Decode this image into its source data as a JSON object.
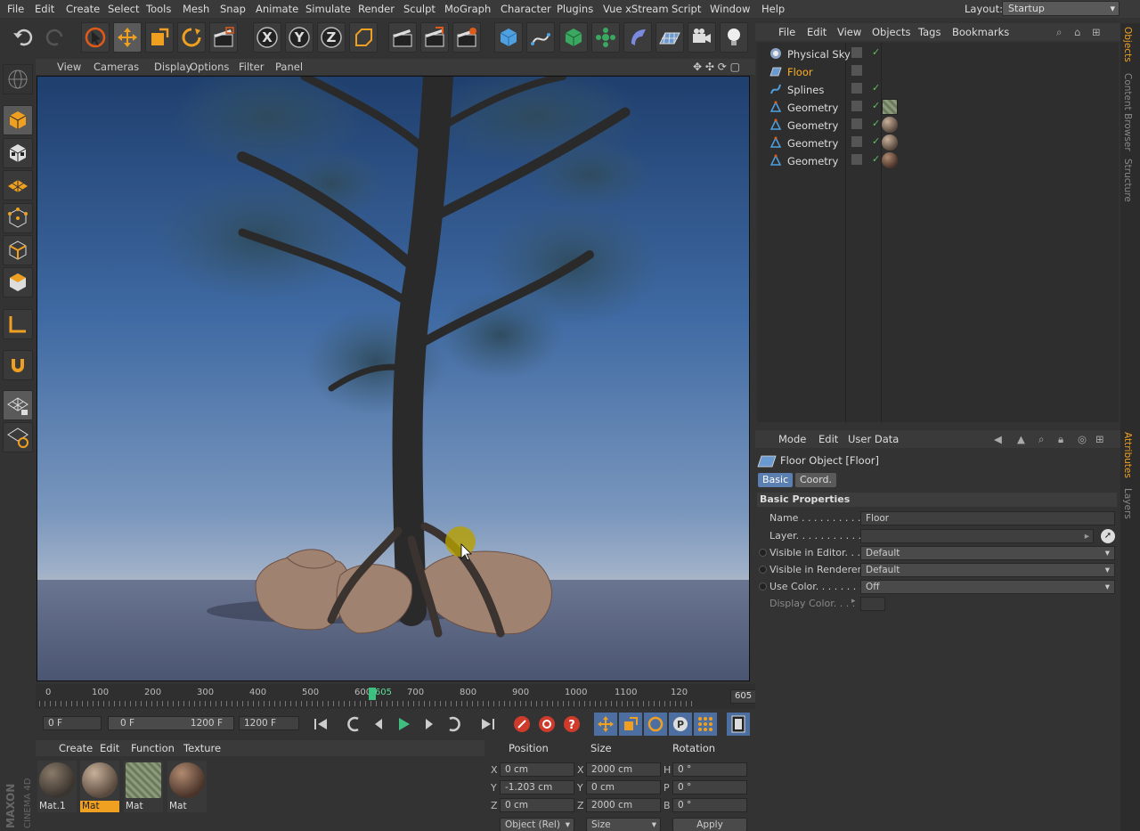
{
  "menu": [
    "File",
    "Edit",
    "Create",
    "Select",
    "Tools",
    "Mesh",
    "Snap",
    "Animate",
    "Simulate",
    "Render",
    "Sculpt",
    "MoGraph",
    "Character",
    "Plugins",
    "Vue xStream",
    "Script",
    "Window",
    "Help"
  ],
  "layout": {
    "label": "Layout:",
    "value": "Startup"
  },
  "viewport": {
    "menu": [
      "View",
      "Cameras",
      "Display",
      "Options",
      "Filter",
      "Panel"
    ]
  },
  "timeline": {
    "ticks": [
      "0",
      "100",
      "200",
      "300",
      "400",
      "500",
      "600",
      "700",
      "800",
      "900",
      "1000",
      "1100",
      "120"
    ],
    "current_marker": "605",
    "current_field": "605 F",
    "playhead_percent": 50.4
  },
  "transport": {
    "start": "0 F",
    "range_start": "0 F",
    "range_end": "1200 F",
    "end": "1200 F"
  },
  "materials": {
    "menu": [
      "Create",
      "Edit",
      "Function",
      "Texture"
    ],
    "items": [
      {
        "label": "Mat.1",
        "selected": false
      },
      {
        "label": "Mat",
        "selected": true
      },
      {
        "label": "Mat",
        "selected": false
      },
      {
        "label": "Mat",
        "selected": false
      }
    ]
  },
  "coords": {
    "headers": [
      "Position",
      "Size",
      "Rotation"
    ],
    "rows": [
      {
        "axis": "X",
        "pos": "0 cm",
        "saxis": "X",
        "size": "2000 cm",
        "raxis": "H",
        "rot": "0 °"
      },
      {
        "axis": "Y",
        "pos": "-1.203 cm",
        "saxis": "Y",
        "size": "0 cm",
        "raxis": "P",
        "rot": "0 °"
      },
      {
        "axis": "Z",
        "pos": "0 cm",
        "saxis": "Z",
        "size": "2000 cm",
        "raxis": "B",
        "rot": "0 °"
      }
    ],
    "mode": "Object (Rel)",
    "size_mode": "Size",
    "apply": "Apply"
  },
  "objects": {
    "menu": [
      "File",
      "Edit",
      "View",
      "Objects",
      "Tags",
      "Bookmarks"
    ],
    "items": [
      {
        "name": "Physical Sky",
        "selected": false
      },
      {
        "name": "Floor",
        "selected": true
      },
      {
        "name": "Splines",
        "selected": false
      },
      {
        "name": "Geometry",
        "selected": false
      },
      {
        "name": "Geometry",
        "selected": false
      },
      {
        "name": "Geometry",
        "selected": false
      },
      {
        "name": "Geometry",
        "selected": false
      }
    ]
  },
  "side_tabs": [
    "Objects",
    "Content Browser",
    "Structure"
  ],
  "side_tabs2": [
    "Attributes",
    "Layers"
  ],
  "attributes": {
    "menu": [
      "Mode",
      "Edit",
      "User Data"
    ],
    "title": "Floor Object [Floor]",
    "tabs": [
      "Basic",
      "Coord."
    ],
    "section": "Basic Properties",
    "props": [
      {
        "label": "Name . . . . . . . . . . . .",
        "value": "Floor"
      },
      {
        "label": "Layer. . . . . . . . . . . .",
        "value": ""
      },
      {
        "label": "Visible in Editor. . .",
        "value": "Default"
      },
      {
        "label": "Visible in Renderer",
        "value": "Default"
      },
      {
        "label": "Use Color. . . . . . . .",
        "value": "Off"
      },
      {
        "label": "Display Color. . . .",
        "value": ""
      }
    ]
  },
  "brand": {
    "maxon": "MAXON",
    "product": "CINEMA 4D"
  },
  "colors": {
    "accent": "#f0a020",
    "selected_text": "#ffb020",
    "check": "#5ec05e"
  }
}
